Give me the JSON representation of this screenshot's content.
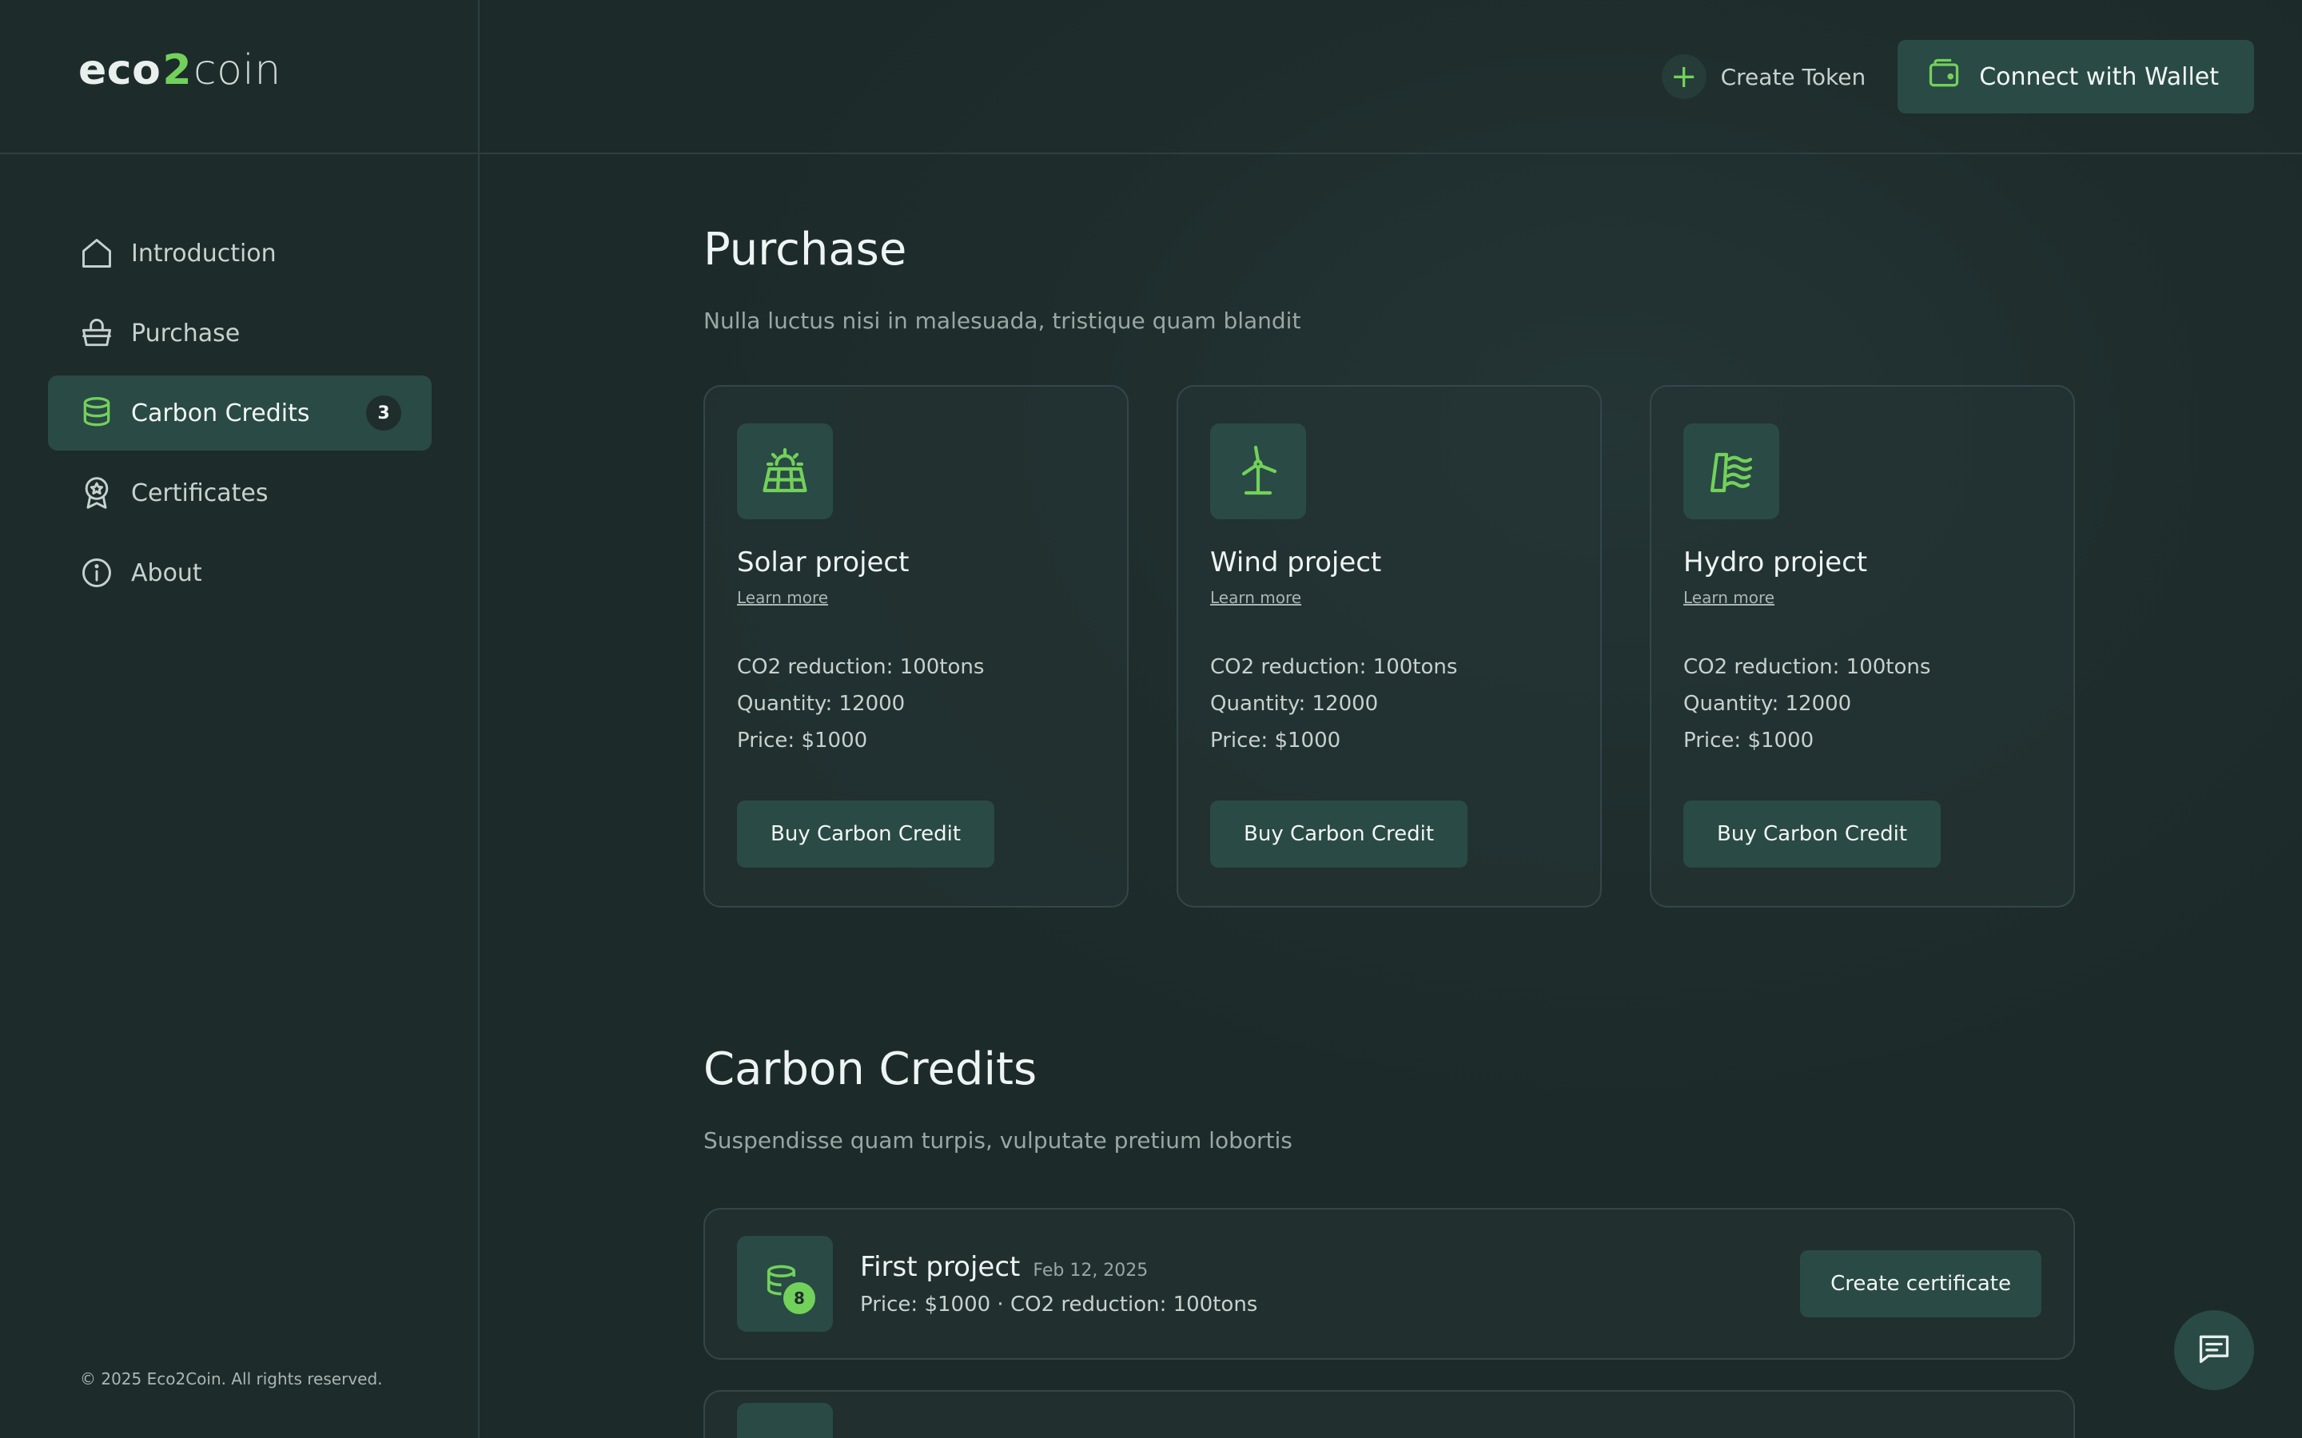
{
  "brand": {
    "part1": "eco",
    "part2": "2",
    "part3": "coin"
  },
  "header": {
    "create_token_label": "Create Token",
    "connect_wallet_label": "Connect with Wallet"
  },
  "sidebar": {
    "items": [
      {
        "label": "Introduction",
        "icon": "home-icon"
      },
      {
        "label": "Purchase",
        "icon": "basket-icon"
      },
      {
        "label": "Carbon Credits",
        "icon": "database-icon",
        "badge": "3",
        "active": true
      },
      {
        "label": "Certificates",
        "icon": "award-icon"
      },
      {
        "label": "About",
        "icon": "info-icon"
      }
    ],
    "footer": "© 2025 Eco2Coin. All rights reserved."
  },
  "purchase": {
    "title": "Purchase",
    "subtitle": "Nulla luctus nisi in malesuada, tristique quam blandit",
    "projects": [
      {
        "title": "Solar project",
        "icon": "solar-panel-icon",
        "learn_more": "Learn more",
        "co2": "CO2 reduction: 100tons",
        "quantity": "Quantity: 12000",
        "price": "Price: $1000",
        "button": "Buy Carbon Credit"
      },
      {
        "title": "Wind project",
        "icon": "wind-turbine-icon",
        "learn_more": "Learn more",
        "co2": "CO2 reduction: 100tons",
        "quantity": "Quantity: 12000",
        "price": "Price: $1000",
        "button": "Buy Carbon Credit"
      },
      {
        "title": "Hydro project",
        "icon": "hydro-dam-icon",
        "learn_more": "Learn more",
        "co2": "CO2 reduction: 100tons",
        "quantity": "Quantity: 12000",
        "price": "Price: $1000",
        "button": "Buy Carbon Credit"
      }
    ]
  },
  "carbon_credits": {
    "title": "Carbon Credits",
    "subtitle": "Suspendisse quam turpis, vulputate pretium lobortis",
    "items": [
      {
        "title": "First project",
        "date": "Feb 12, 2025",
        "meta": "Price: $1000 · CO2 reduction: 100tons",
        "count": "8",
        "button": "Create certificate"
      }
    ]
  },
  "colors": {
    "accent": "#72d15a",
    "background": "#1f2d2d",
    "button": "#2a4a45"
  }
}
